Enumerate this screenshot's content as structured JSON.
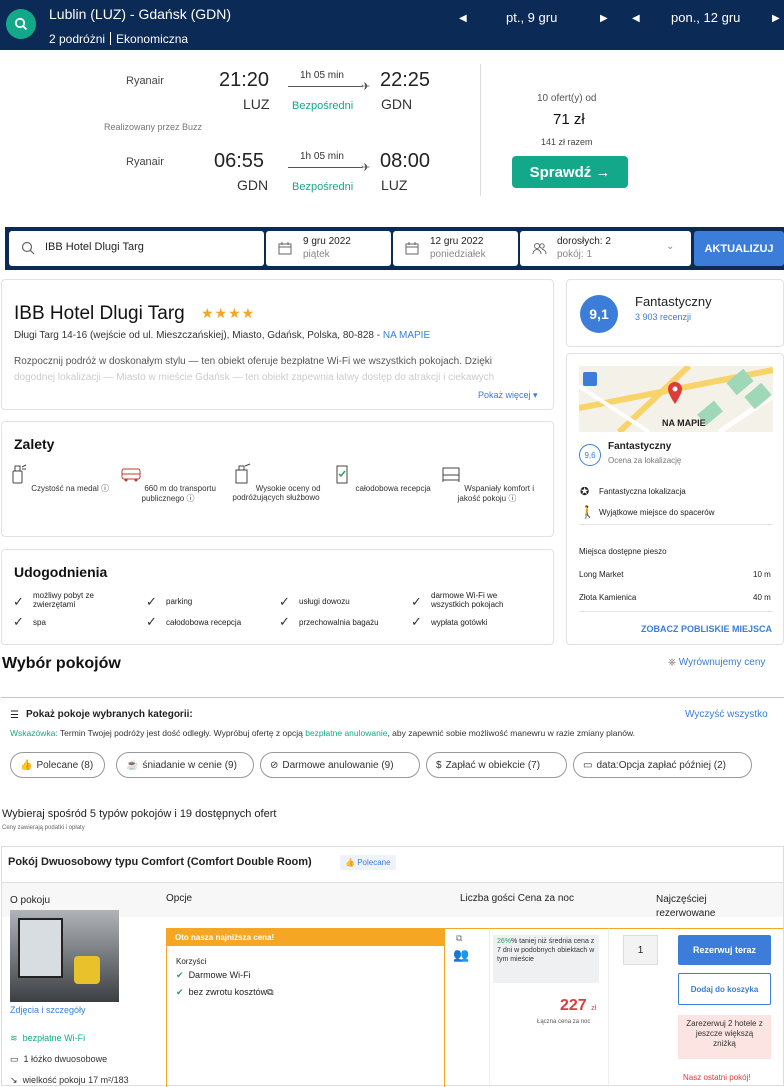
{
  "topbar": {
    "route": "Lublin (LUZ) - Gdańsk (GDN)",
    "travellers": "2 podróżni",
    "cabin": "Ekonomiczna",
    "date_out": "pt., 9 gru",
    "date_back": "pon., 12 gru"
  },
  "flights": [
    {
      "airline": "Ryanair",
      "dep_time": "21:20",
      "dep_code": "LUZ",
      "duration": "1h 05 min",
      "type": "Bezpośredni",
      "arr_time": "22:25",
      "arr_code": "GDN"
    },
    {
      "airline": "Ryanair",
      "dep_time": "06:55",
      "dep_code": "GDN",
      "duration": "1h 05 min",
      "type": "Bezpośredni",
      "arr_time": "08:00",
      "arr_code": "LUZ"
    }
  ],
  "operated_by": "Realizowany przez Buzz",
  "offer": {
    "count": "10 ofert(y) od",
    "price": "71 zł",
    "total": "141 zł razem",
    "cta": "Sprawdź"
  },
  "search": {
    "hotel": "IBB Hotel Dlugi Targ",
    "checkin_date": "9 gru 2022",
    "checkin_day": "piątek",
    "checkout_date": "12 gru 2022",
    "checkout_day": "poniedziałek",
    "adults": "dorosłych: 2",
    "rooms": "pokój: 1",
    "update": "AKTUALIZUJ"
  },
  "hotel": {
    "name": "IBB Hotel Dlugi Targ",
    "stars": "★★★★",
    "address": "Długi Targ 14-16 (wejście od ul. Mieszczańskiej), Miasto, Gdańsk, Polska, 80-828 -",
    "map_link": "NA MAPIE",
    "desc1": "Rozpocznij podróż w doskonałym stylu — ten obiekt oferuje bezpłatne Wi-Fi we wszystkich pokojach. Dzięki",
    "desc2": "dogodnej lokalizacji — Miasto w mieście Gdańsk — ten obiekt zapewnia łatwy dostęp do atrakcji i ciekawych",
    "show_more": "Pokaż więcej"
  },
  "rating": {
    "score": "9,1",
    "label": "Fantastyczny",
    "reviews": "3 903 recenzji"
  },
  "map": {
    "label": "NA MAPIE",
    "loc_score": "9,6",
    "loc_label": "Fantastyczny",
    "loc_sub": "Ocena za lokalizację",
    "feature1": "Fantastyczna lokalizacja",
    "feature2": "Wyjątkowe miejsce do spacerów",
    "walk_title": "Miejsca dostępne pieszo",
    "places": [
      {
        "name": "Long Market",
        "dist": "10 m"
      },
      {
        "name": "Złota Kamienica",
        "dist": "40 m"
      }
    ],
    "see_nearby": "ZOBACZ POBLISKIE MIEJSCA"
  },
  "advantages": {
    "title": "Zalety",
    "items": [
      "Czystość na medal",
      "660 m do transportu publicznego",
      "Wysokie oceny od podróżujących służbowo",
      "całodobowa recepcja",
      "Wspaniały komfort i jakość pokoju"
    ]
  },
  "facilities": {
    "title": "Udogodnienia",
    "items": [
      "możliwy pobyt ze zwierzętami",
      "parking",
      "usługi dowozu",
      "darmowe Wi-Fi we wszystkich pokojach",
      "spa",
      "całodobowa recepcja",
      "przechowalnia bagażu",
      "wypłata gotówki"
    ]
  },
  "rooms_section": {
    "title": "Wybór pokojów",
    "match": "Wyrównujemy ceny",
    "filter_title": "Pokaż pokoje wybranych kategorii:",
    "clear_all": "Wyczyść wszystko",
    "hint_label": "Wskazówka:",
    "hint_text_a": " Termin Twojej podróży jest dość odległy. Wypróbuj ofertę z opcją ",
    "hint_link": "bezpłatne anulowanie",
    "hint_text_b": ", aby zapewnić sobie możliwość manewru w razie zmiany planów.",
    "pills": [
      "Polecane (8)",
      "śniadanie w cenie (9)",
      "Darmowe anulowanie (9)",
      "Zapłać w obiekcie (7)",
      "data:Opcja zapłać później (2)"
    ],
    "summary": "Wybieraj spośród 5 typów pokojów i 19 dostępnych ofert",
    "taxes_note": "Ceny zawierają podatki i opłaty"
  },
  "room": {
    "name": "Pokój Dwuosobowy typu Comfort (Comfort Double Room)",
    "badge": "Polecane",
    "col_about": "O pokoju",
    "col_options": "Opcje",
    "col_guests_price": "Liczba gości Cena za noc",
    "col_popular": "Najczęściej rezerwowane",
    "best_price": "Oto nasza najniższa cena!",
    "benefits_title": "Korzyści",
    "benefit1": "Darmowe Wi-Fi",
    "benefit2": "bez zwrotu kosztów",
    "deal_pct": "26%",
    "deal_text": "% taniej niż średnia cena z 7 dni w podobnych obiektach w tym mieście",
    "price": "227",
    "currency": "zł",
    "price_note": "Łączna cena za noc",
    "qty": "1",
    "reserve": "Rezerwuj teraz",
    "add_cart": "Dodaj do koszyka",
    "promo": "Zarezerwuj 2 hotele z jeszcze większą zniżką",
    "last_room": "Nasz ostatni pokój!",
    "photos_link": "Zdjęcia i szczegóły",
    "amenity1": "bezpłatne Wi-Fi",
    "amenity2": "1 łóżko dwuosobowe",
    "amenity3": "wielkość pokoju 17 m²/183"
  }
}
